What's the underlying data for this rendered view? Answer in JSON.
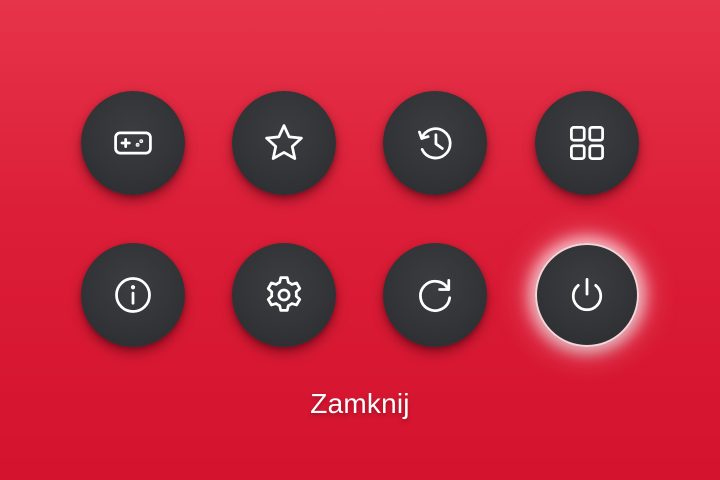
{
  "menu": {
    "buttons": [
      {
        "id": "games",
        "icon": "gamepad-icon",
        "selected": false
      },
      {
        "id": "favorites",
        "icon": "star-icon",
        "selected": false
      },
      {
        "id": "history",
        "icon": "history-icon",
        "selected": false
      },
      {
        "id": "apps",
        "icon": "apps-grid-icon",
        "selected": false
      },
      {
        "id": "info",
        "icon": "info-icon",
        "selected": false
      },
      {
        "id": "settings",
        "icon": "gear-icon",
        "selected": false
      },
      {
        "id": "restart",
        "icon": "refresh-icon",
        "selected": false
      },
      {
        "id": "power",
        "icon": "power-icon",
        "selected": true
      }
    ],
    "selected_label": "Zamknij"
  },
  "colors": {
    "background_top": "#e6344a",
    "background_bottom": "#d4132e",
    "button": "#333437",
    "icon": "#ffffff",
    "selection_glow": "#f4d6da"
  }
}
